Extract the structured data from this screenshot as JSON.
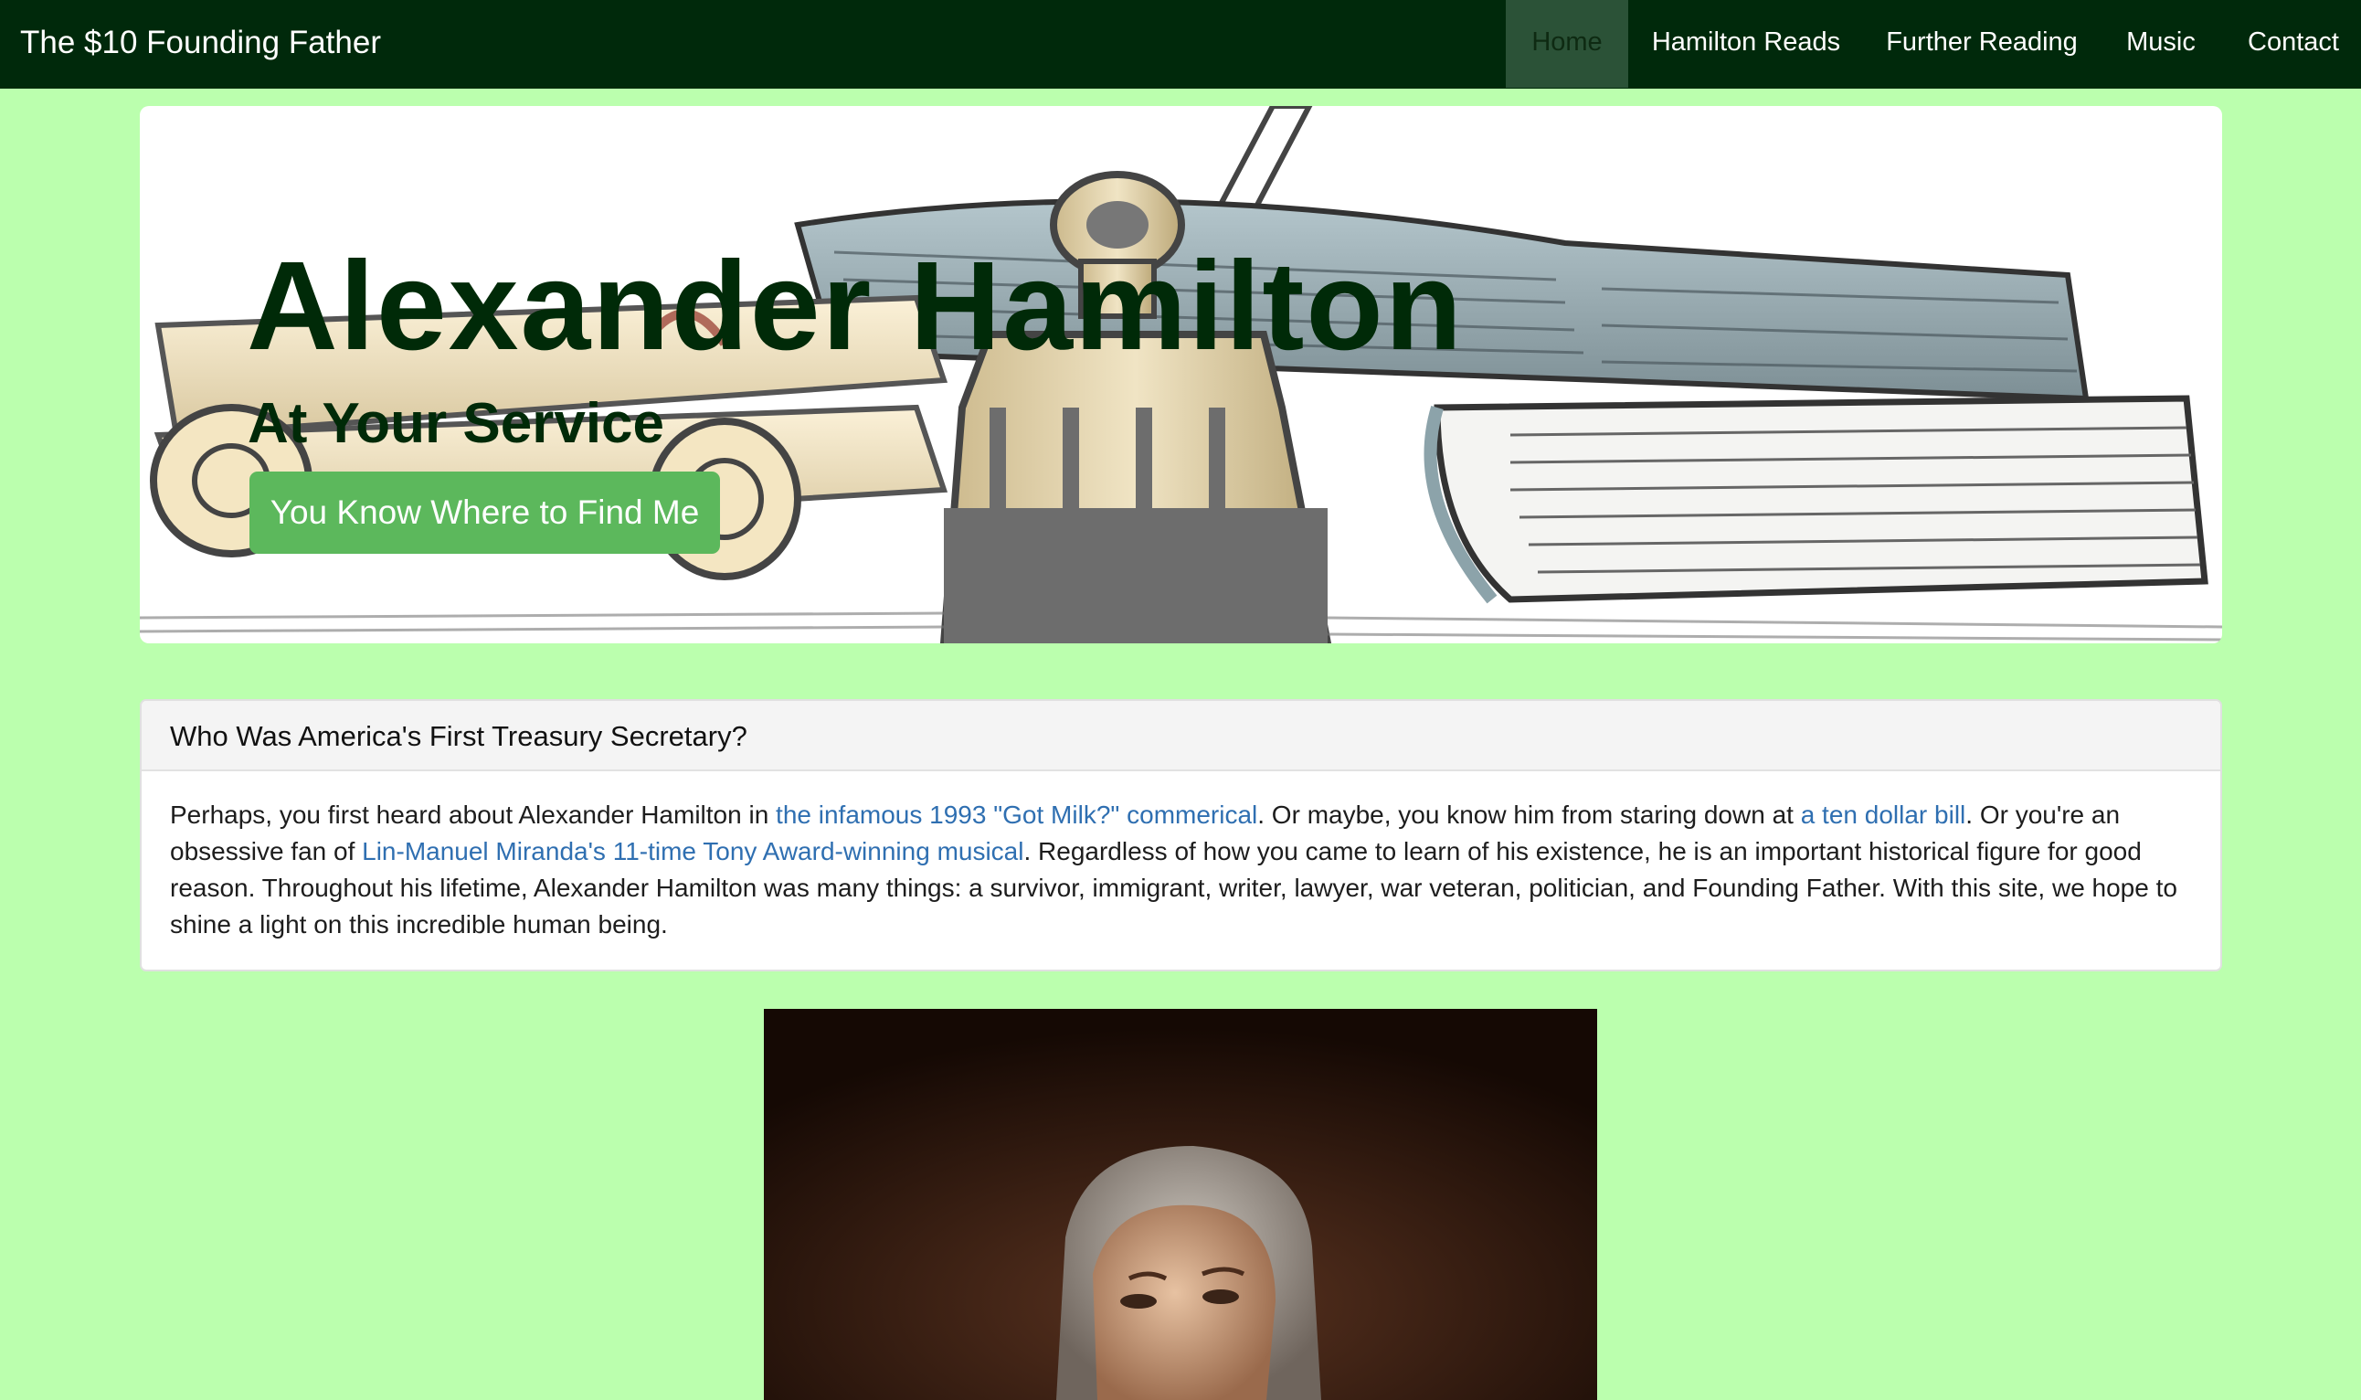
{
  "navbar": {
    "brand": "The $10 Founding Father",
    "items": [
      {
        "label": "Home",
        "active": true
      },
      {
        "label": "Hamilton Reads",
        "active": false
      },
      {
        "label": "Further Reading",
        "active": false
      },
      {
        "label": "Music",
        "active": false
      },
      {
        "label": "Contact",
        "active": false
      }
    ]
  },
  "hero": {
    "title": "Alexander Hamilton",
    "subtitle": "At Your Service",
    "button_label": "You Know Where to Find Me"
  },
  "panel": {
    "heading": "Who Was America's First Treasury Secretary?",
    "body": {
      "t1": "Perhaps, you first heard about Alexander Hamilton in ",
      "link1": "the infamous 1993 \"Got Milk?\" commerical",
      "t2": ". Or maybe, you know him from staring down at ",
      "link2": "a ten dollar bill",
      "t3": ". Or you're an obsessive fan of ",
      "link3": "Lin-Manuel Miranda's 11-time Tony Award-winning musical",
      "t4": ". Regardless of how you came to learn of his existence, he is an important historical figure for good reason. Throughout his lifetime, Alexander Hamilton was many things: a survivor, immigrant, writer, lawyer, war veteran, politician, and Founding Father. With this site, we hope to shine a light on this incredible human being."
    }
  },
  "colors": {
    "page_background": "#bbffae",
    "navbar_background": "#00290b",
    "nav_active_background": "#2b5237",
    "hero_text": "#002a08",
    "button": "#5cb85c",
    "link": "#2f6fb1"
  }
}
